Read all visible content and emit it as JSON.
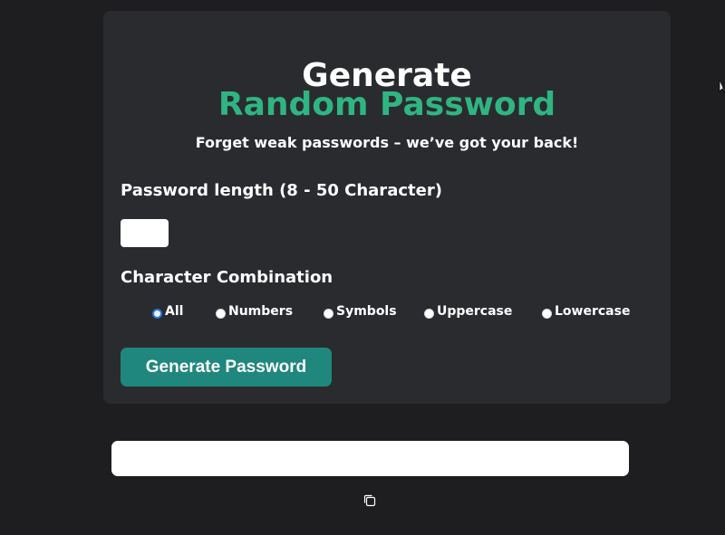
{
  "header": {
    "title_line1": "Generate",
    "title_line2": "Random Password",
    "subtitle": "Forget weak passwords – we’ve got your back!"
  },
  "length": {
    "label": "Password length (8 - 50 Character)",
    "value": ""
  },
  "combination": {
    "label": "Character Combination",
    "options": [
      "All",
      "Numbers",
      "Symbols",
      "Uppercase",
      "Lowercase"
    ],
    "selected": "All"
  },
  "actions": {
    "generate_label": "Generate Password"
  },
  "output": {
    "value": ""
  },
  "icons": {
    "copy": "copy-icon",
    "cursor": "mouse-cursor-icon"
  },
  "colors": {
    "background": "#1e1e20",
    "card": "#2a2b2f",
    "accent_green": "#2fb582",
    "button": "#1f877d",
    "text": "#ffffff"
  }
}
